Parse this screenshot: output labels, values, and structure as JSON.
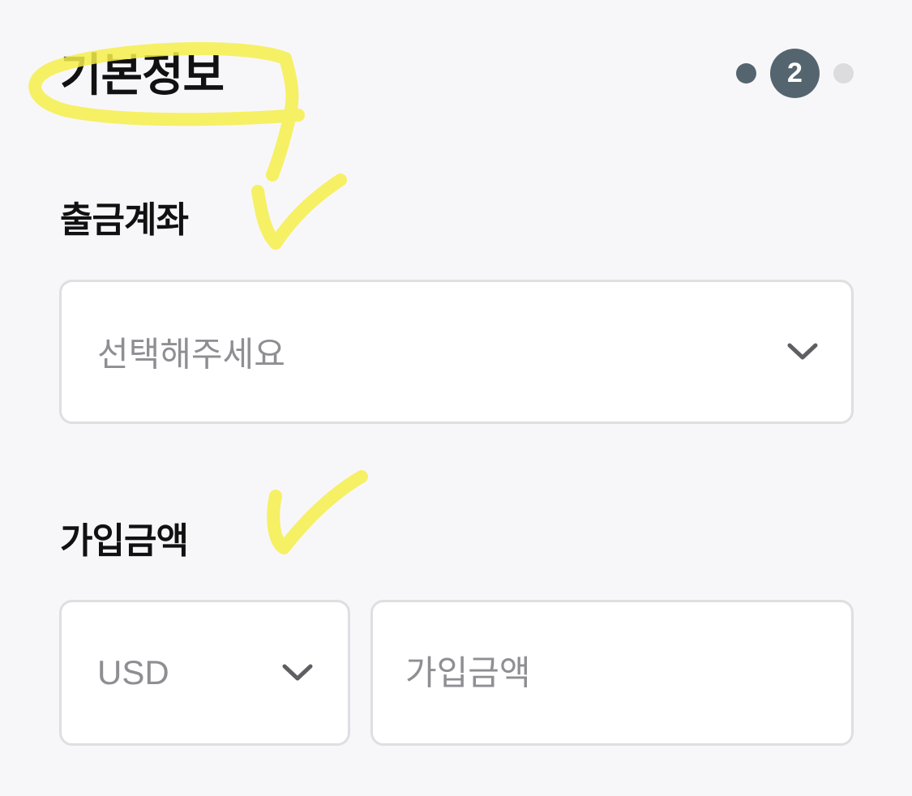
{
  "header": {
    "title": "기본정보",
    "current_step": "2"
  },
  "account_section": {
    "label": "출금계좌",
    "select_placeholder": "선택해주세요"
  },
  "amount_section": {
    "label": "가입금액",
    "currency_value": "USD",
    "amount_placeholder": "가입금액"
  },
  "icons": {
    "account_dropdown": "chevron-down-icon",
    "currency_dropdown": "chevron-down-icon"
  },
  "colors": {
    "step_active": "#556570",
    "step_done": "#556570",
    "step_pending": "#dcdcdf",
    "highlighter": "#f6ef4a"
  }
}
